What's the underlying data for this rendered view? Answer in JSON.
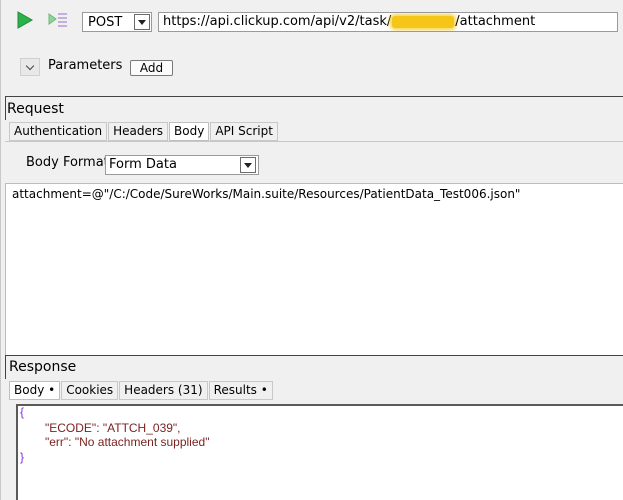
{
  "toolbar": {
    "run_icon": "play-icon",
    "step_icon": "step-run-icon",
    "method": "POST",
    "url_prefix": "https://api.clickup.com/api/v2/task/",
    "url_suffix": "/attachment"
  },
  "parameters": {
    "label": "Parameters",
    "add_label": "Add"
  },
  "request": {
    "title": "Request",
    "tabs": [
      {
        "label": "Authentication"
      },
      {
        "label": "Headers"
      },
      {
        "label": "Body"
      },
      {
        "label": "API Script"
      }
    ],
    "body_format_label": "Body Format",
    "body_format_value": "Form Data",
    "body_text": "attachment=@\"/C:/Code/SureWorks/Main.suite/Resources/PatientData_Test006.json\""
  },
  "response": {
    "title": "Response",
    "tabs": [
      {
        "label": "Body •"
      },
      {
        "label": "Cookies"
      },
      {
        "label": "Headers (31)"
      },
      {
        "label": "Results •"
      }
    ],
    "json_open": "{",
    "line1": "\"ECODE\": \"ATTCH_039\",",
    "line2": "\"err\": \"No attachment supplied\"",
    "json_close": "}"
  },
  "colors": {
    "play_green": "#2bb34a",
    "redaction": "#f5c518",
    "json_brace": "#8a2be2",
    "json_text": "#7a1f1f"
  }
}
